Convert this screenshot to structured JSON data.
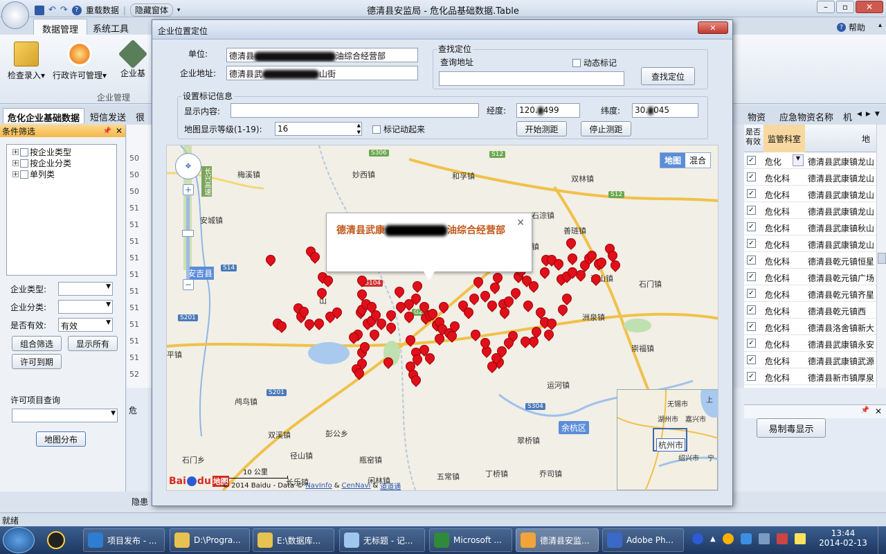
{
  "app": {
    "title": "德清县安监局 - 危化品基础数据.Table",
    "quick_reload": "重载数据",
    "quick_hide": "隐藏窗体",
    "help": "帮助"
  },
  "ribbon": {
    "tabs": [
      "数据管理",
      "系统工具"
    ],
    "buttons": [
      "检查录入",
      "行政许可管理",
      "企业基"
    ],
    "group_label": "企业管理"
  },
  "doc_tabs": [
    "危化企业基础数据",
    "短信发送",
    "很"
  ],
  "right_tabs": [
    "物资",
    "应急物资名称",
    "机"
  ],
  "left_panel": {
    "title": "条件筛选",
    "tree": [
      "按企业类型",
      "按企业分类",
      "单列类"
    ],
    "filter_type_label": "企业类型:",
    "filter_class_label": "企业分类:",
    "filter_valid_label": "是否有效:",
    "filter_valid_value": "有效",
    "btn_combo": "组合筛选",
    "btn_show_all": "显示所有",
    "btn_expire": "许可到期",
    "license_query_label": "许可项目查询",
    "btn_map": "地图分布"
  },
  "background_rows": [
    "50",
    "50",
    "50",
    "51",
    "51",
    "51",
    "51",
    "51",
    "51",
    "51",
    "51",
    "51",
    "51",
    "52"
  ],
  "grid": {
    "col_valid": "是否有效",
    "col_dept": "监管科室",
    "col_addr": "地",
    "rows": [
      {
        "dept": "危化",
        "addr": "德清县武康镇龙山"
      },
      {
        "dept": "危化科",
        "addr": "德清县武康镇龙山"
      },
      {
        "dept": "危化科",
        "addr": "德清县武康镇龙山"
      },
      {
        "dept": "危化科",
        "addr": "德清县武康镇龙山"
      },
      {
        "dept": "危化科",
        "addr": "德清县武康镇秋山"
      },
      {
        "dept": "危化科",
        "addr": "德清县武康镇龙山"
      },
      {
        "dept": "危化科",
        "addr": "德清县乾元镇恒星"
      },
      {
        "dept": "危化科",
        "addr": "德清县乾元镇广场"
      },
      {
        "dept": "危化科",
        "addr": "德清县乾元镇齐星"
      },
      {
        "dept": "危化科",
        "addr": "德清县乾元镇西"
      },
      {
        "dept": "危化科",
        "addr": "德清县洛舍镇新大"
      },
      {
        "dept": "危化科",
        "addr": "德清县武康镇永安"
      },
      {
        "dept": "危化科",
        "addr": "德清县武康镇武源"
      },
      {
        "dept": "危化科",
        "addr": "德清县新市镇厚泉"
      }
    ],
    "bottom_label": "危",
    "bottom_btn": "易制毒显示",
    "hidden_label": "隐患"
  },
  "dialog": {
    "title": "企业位置定位",
    "unit_label": "单位:",
    "unit_value_a": "德清县",
    "unit_value_b": "油综合经营部",
    "address_label": "企业地址:",
    "address_value_a": "德清县武",
    "address_value_b": "山街",
    "search_group": "查找定位",
    "search_addr_label": "查询地址",
    "dynamic_mark": "动态标记",
    "btn_search": "查找定位",
    "mark_group": "设置标记信息",
    "display_label": "显示内容:",
    "lng_label": "经度:",
    "lng_a": "120.",
    "lng_b": "499",
    "lat_label": "纬度:",
    "lat_a": "30.",
    "lat_b": "045",
    "zoom_label": "地图显示等级(1-19):",
    "zoom_value": "16",
    "animate_label": "标记动起来",
    "btn_start": "开始测距",
    "btn_stop": "停止测距"
  },
  "map": {
    "type_map": "地图",
    "type_mix": "混合",
    "popup_a": "德清县武康",
    "popup_b": "油综合经营部",
    "scale": "10 公里",
    "copyright_prefix": "© 2014 Baidu - Data ©",
    "copyright_navinfo": "NavInfo",
    "copyright_amp1": "&",
    "copyright_cennavi": "CenNavi",
    "copyright_amp2": "&",
    "copyright_daodao": "道道通",
    "logo_bai": "Bai",
    "logo_du": "du",
    "logo_ditu": "地图",
    "towns": [
      "梅溪镇",
      "妙西镇",
      "和孚镇",
      "双林镇",
      "安城镇",
      "石淙镇",
      "善琏镇",
      "金镇",
      "河山镇",
      "石门镇",
      "洲泉镇",
      "平镇",
      "崇福镇",
      "运河镇",
      "鸬鸟镇",
      "双溪镇",
      "彭公乡",
      "径山镇",
      "瓶窑镇",
      "石门乡",
      "长乐镇",
      "闲林镇",
      "五常镇",
      "乔司镇",
      "翠桥镇",
      "丁桥镇",
      "余杭区",
      "安吉县",
      "山",
      "长兴高速"
    ],
    "shields": [
      "S306",
      "S12",
      "S12",
      "S14",
      "G104",
      "G25",
      "S201",
      "S201",
      "S304"
    ],
    "inset_towns": [
      "无锡市",
      "湖州市",
      "嘉兴市",
      "杭州市",
      "绍兴市",
      "上",
      "宁"
    ]
  },
  "status": "就绪",
  "taskbar": {
    "items": [
      "项目发布 - ...",
      "D:\\Progra...",
      "E:\\数据库...",
      "无标题 - 记...",
      "Microsoft ...",
      "德清县安监...",
      "Adobe Ph..."
    ],
    "time": "13:44",
    "date": "2014-02-13"
  }
}
